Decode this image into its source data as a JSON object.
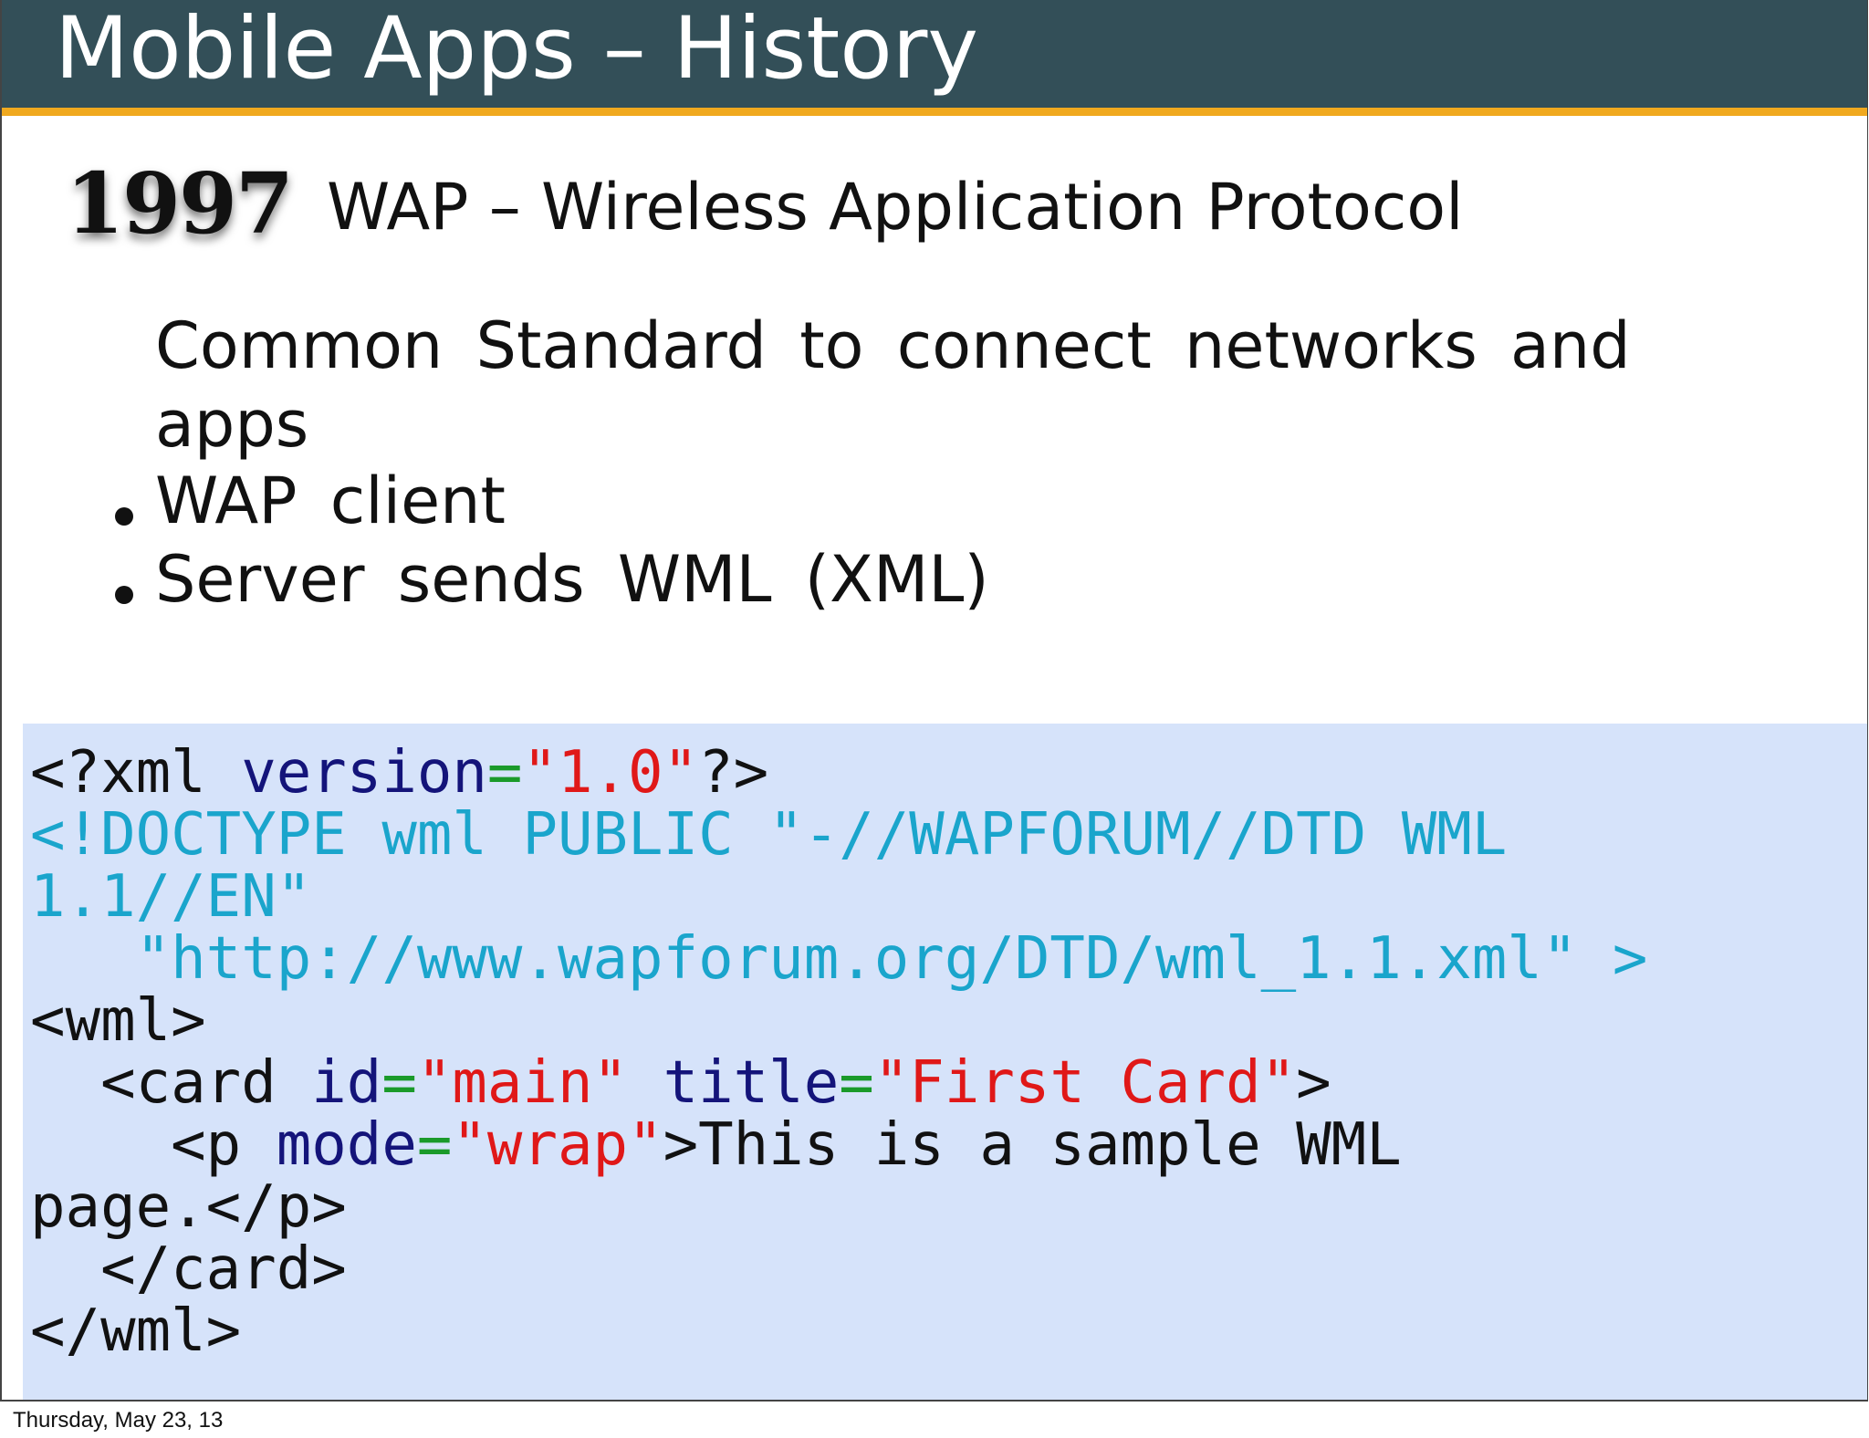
{
  "slide": {
    "title": "Mobile Apps – History",
    "year": "1997",
    "heading": "WAP – Wireless Application Protocol",
    "description_line1": "Common Standard to connect networks and",
    "description_line2": "apps",
    "bullets": [
      "WAP client",
      "Server sends WML (XML)"
    ]
  },
  "code": {
    "line1": {
      "t1": "<?xml ",
      "t2": "version",
      "t3": "=",
      "t4": "\"1.0\"",
      "t5": "?>"
    },
    "line2": "<!DOCTYPE wml PUBLIC \"-//WAPFORUM//DTD WML",
    "line3": "1.1//EN\"",
    "line4": "   \"http://www.wapforum.org/DTD/wml_1.1.xml\" >",
    "line5": "<wml>",
    "line6": {
      "t1": "  <card ",
      "t2": "id",
      "t3": "=",
      "t4": "\"main\"",
      "t5": " ",
      "t6": "title",
      "t7": "=",
      "t8": "\"First Card\"",
      "t9": ">"
    },
    "line7": {
      "t1": "    <p ",
      "t2": "mode",
      "t3": "=",
      "t4": "\"wrap\"",
      "t5": ">This is a sample WML"
    },
    "line8": "page.</p>",
    "line9": "  </card>",
    "line10": "</wml>"
  },
  "footer": {
    "date": "Thursday, May 23, 13"
  },
  "colors": {
    "title_bar": "#334f58",
    "title_underline": "#f0a91f",
    "code_background": "#d6e3fa",
    "code_tag": "#111111",
    "code_attribute": "#14147a",
    "code_equals": "#1a9a2a",
    "code_string": "#e01818",
    "code_doctype": "#1aa5cc"
  }
}
